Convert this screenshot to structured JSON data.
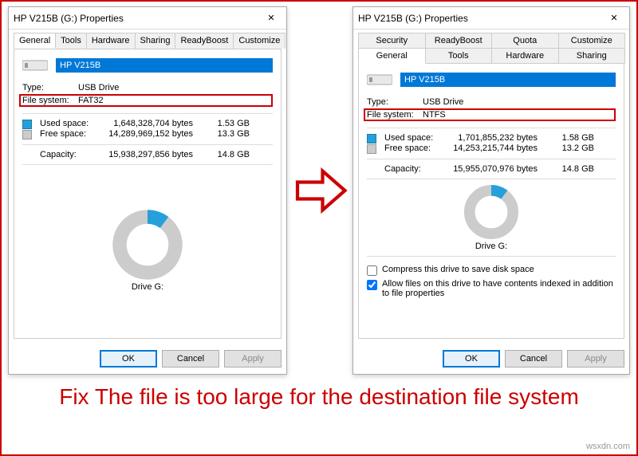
{
  "window_title": "HP V215B (G:) Properties",
  "close_label": "✕",
  "tabs_row1": [
    "General",
    "Tools",
    "Hardware",
    "Sharing",
    "ReadyBoost",
    "Customize"
  ],
  "tabs_d2_row1": [
    "Security",
    "ReadyBoost",
    "Quota",
    "Customize"
  ],
  "tabs_d2_row2": [
    "General",
    "Tools",
    "Hardware",
    "Sharing"
  ],
  "drive_name": "HP V215B",
  "left": {
    "type_label": "Type:",
    "type_value": "USB Drive",
    "fs_label": "File system:",
    "fs_value": "FAT32",
    "used_label": "Used space:",
    "used_bytes": "1,648,328,704 bytes",
    "used_gb": "1.53 GB",
    "free_label": "Free space:",
    "free_bytes": "14,289,969,152 bytes",
    "free_gb": "13.3 GB",
    "cap_label": "Capacity:",
    "cap_bytes": "15,938,297,856 bytes",
    "cap_gb": "14.8 GB",
    "drive_label": "Drive G:"
  },
  "right": {
    "type_label": "Type:",
    "type_value": "USB Drive",
    "fs_label": "File system:",
    "fs_value": "NTFS",
    "used_label": "Used space:",
    "used_bytes": "1,701,855,232 bytes",
    "used_gb": "1.58 GB",
    "free_label": "Free space:",
    "free_bytes": "14,253,215,744 bytes",
    "free_gb": "13.2 GB",
    "cap_label": "Capacity:",
    "cap_bytes": "15,955,070,976 bytes",
    "cap_gb": "14.8 GB",
    "drive_label": "Drive G:",
    "compress_label": "Compress this drive to save disk space",
    "index_label": "Allow files on this drive to have contents indexed in addition to file properties"
  },
  "buttons": {
    "ok": "OK",
    "cancel": "Cancel",
    "apply": "Apply"
  },
  "caption": "Fix The file is too large for the destination file system",
  "watermark": "wsxdn.com"
}
